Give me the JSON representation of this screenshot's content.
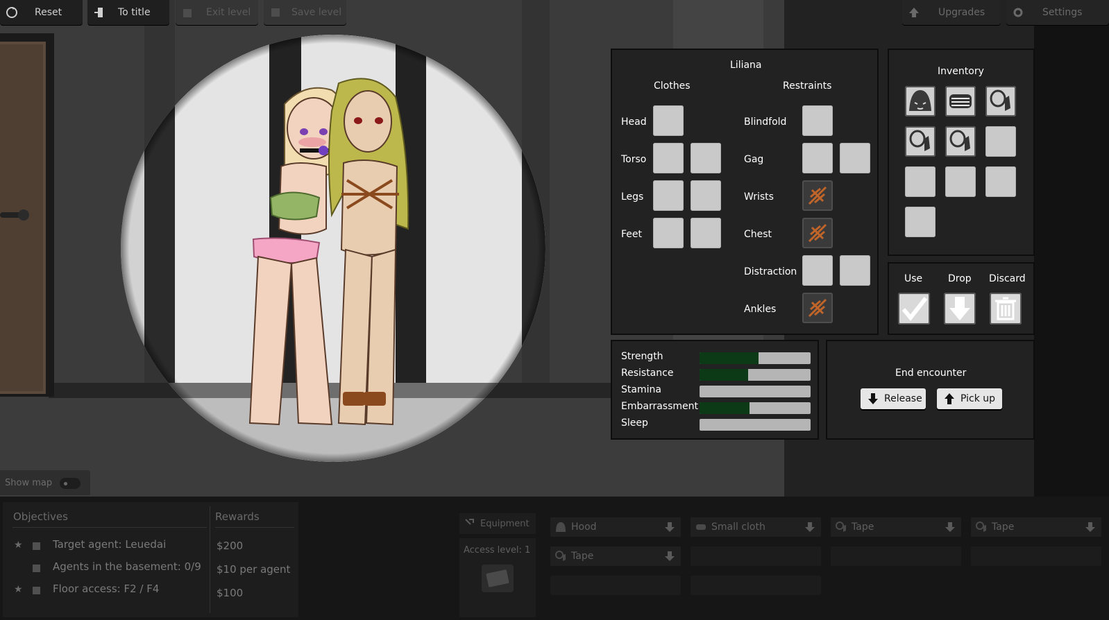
{
  "topbar": {
    "reset": "Reset",
    "to_title": "To title",
    "exit_level": "Exit level",
    "save_level": "Save level",
    "upgrades": "Upgrades",
    "settings": "Settings"
  },
  "character": {
    "name": "Liliana",
    "clothes_header": "Clothes",
    "restraints_header": "Restraints",
    "clothes": [
      "Head",
      "Torso",
      "Legs",
      "Feet"
    ],
    "restraints": [
      "Blindfold",
      "Gag",
      "Wrists",
      "Chest",
      "Distraction",
      "Ankles"
    ]
  },
  "inventory": {
    "title": "Inventory",
    "items": [
      "hood-icon",
      "small-cloth-icon",
      "tape-icon",
      "tape-icon",
      "tape-icon",
      "empty",
      "empty",
      "empty",
      "empty",
      "empty"
    ]
  },
  "actions": {
    "use": "Use",
    "drop": "Drop",
    "discard": "Discard"
  },
  "stats": [
    {
      "label": "Strength",
      "value": 0.53
    },
    {
      "label": "Resistance",
      "value": 0.44
    },
    {
      "label": "Stamina",
      "value": 0.0
    },
    {
      "label": "Embarrassment",
      "value": 0.45
    },
    {
      "label": "Sleep",
      "value": 0.0
    }
  ],
  "encounter": {
    "title": "End encounter",
    "release": "Release",
    "pickup": "Pick up"
  },
  "show_map": "Show map",
  "objectives": {
    "header": "Objectives",
    "rewards_header": "Rewards",
    "rows": [
      {
        "text": "Target agent: Leuedai",
        "reward": "$200",
        "starred": true
      },
      {
        "text": "Agents in the basement: 0/9",
        "reward": "$10 per agent",
        "starred": false
      },
      {
        "text": "Floor access: F2 / F4",
        "reward": "$100",
        "starred": true
      }
    ]
  },
  "equipment": {
    "tab": "Equipment",
    "access_level": "Access level: 1",
    "slots": [
      "Hood",
      "Small cloth",
      "Tape",
      "Tape",
      "Tape"
    ]
  },
  "colors": {
    "bar_fill": "#0c3a16",
    "rope": "#c0652a",
    "panel_bg": "#222222"
  }
}
